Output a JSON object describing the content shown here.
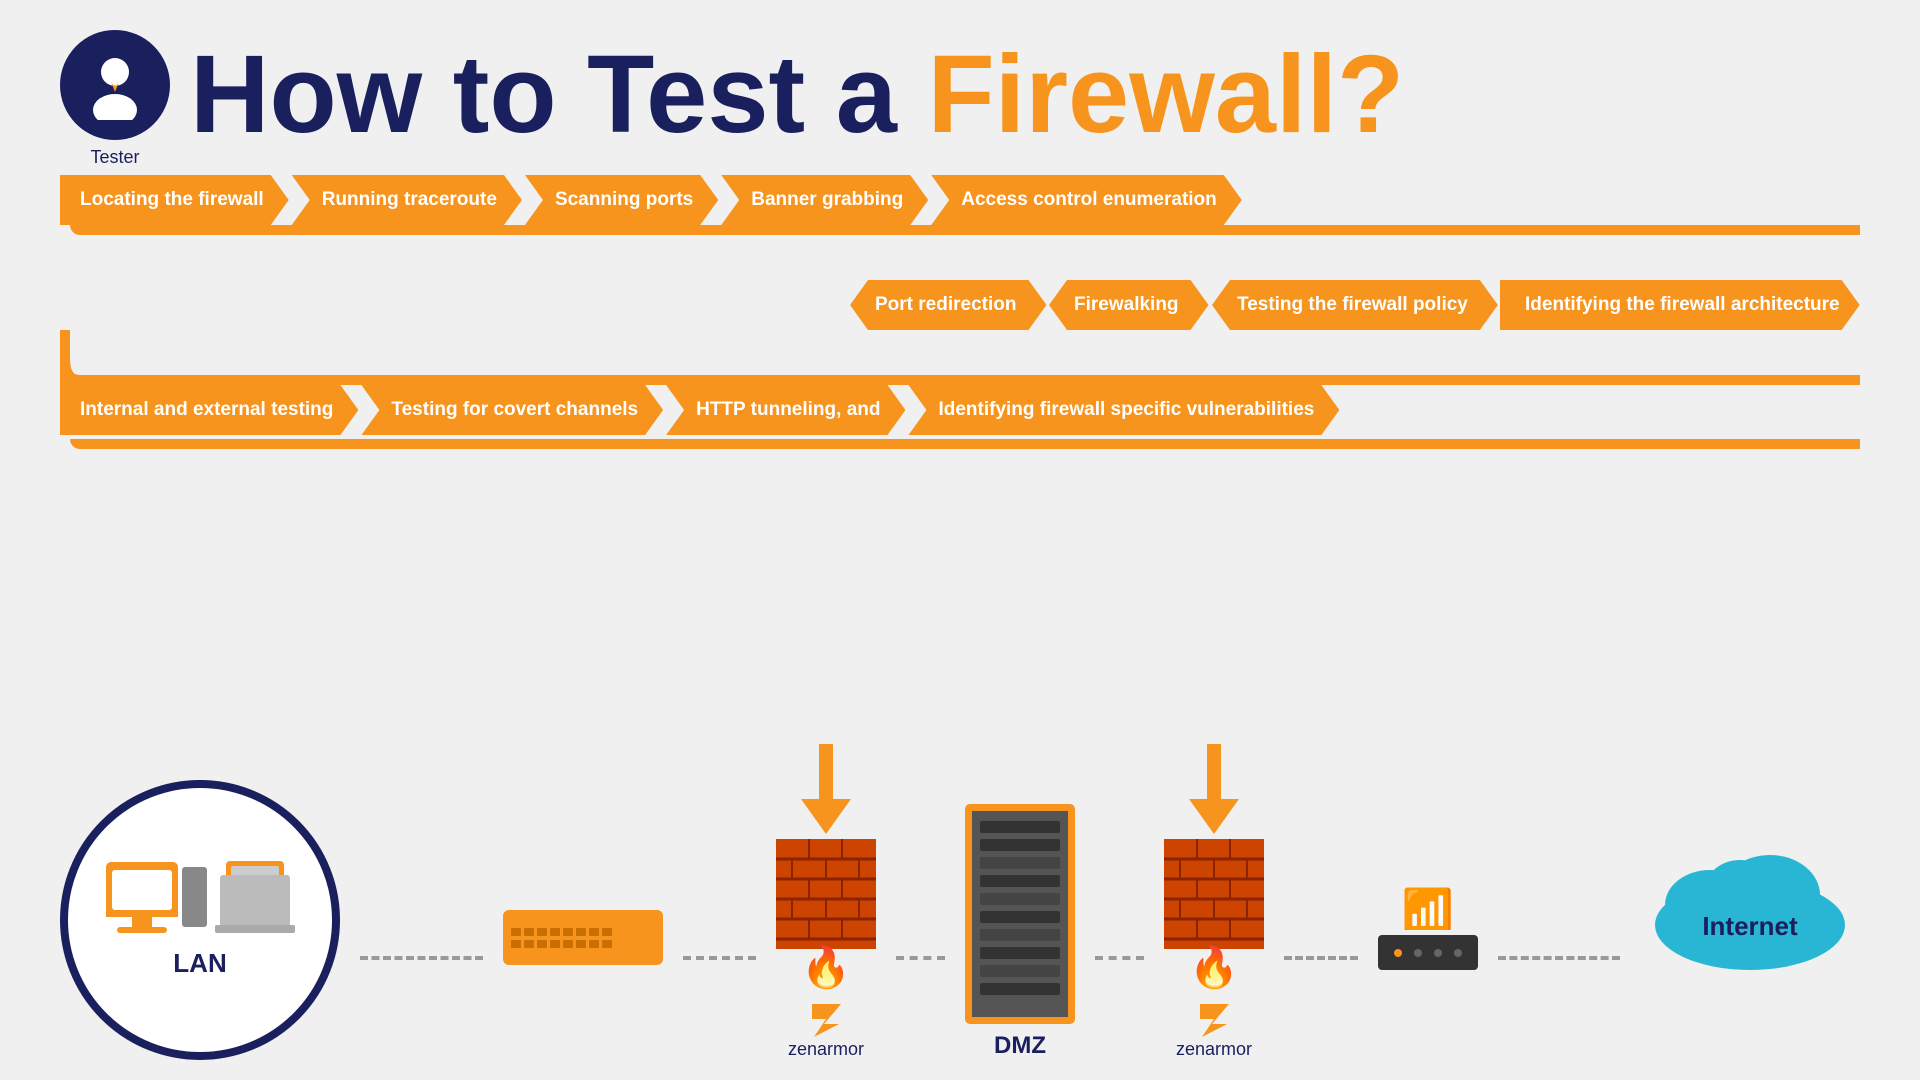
{
  "header": {
    "title_part1": "How to Test a ",
    "title_part2": "Firewall?",
    "tester_label": "Tester"
  },
  "steps": {
    "row1": [
      {
        "label": "Locating the firewall",
        "first": true
      },
      {
        "label": "Running traceroute",
        "first": false
      },
      {
        "label": "Scanning ports",
        "first": false
      },
      {
        "label": "Banner grabbing",
        "first": false
      },
      {
        "label": "Access control enumeration",
        "first": false
      }
    ],
    "row2": [
      {
        "label": "Port redirection",
        "first": true
      },
      {
        "label": "Firewalking",
        "first": false
      },
      {
        "label": "Testing the firewall policy",
        "first": false
      },
      {
        "label": "Identifying the firewall architecture",
        "first": false
      }
    ],
    "row3": [
      {
        "label": "Internal and external testing",
        "first": true
      },
      {
        "label": "Testing for covert channels",
        "first": false
      },
      {
        "label": "HTTP tunneling, and",
        "first": false
      },
      {
        "label": "Identifying firewall specific vulnerabilities",
        "first": false
      }
    ]
  },
  "diagram": {
    "lan_label": "LAN",
    "dmz_label": "DMZ",
    "internet_label": "Internet",
    "zenarmor_label": "zenarmor",
    "tester_label": "Tester"
  },
  "colors": {
    "orange": "#f7941d",
    "navy": "#1a1f5e",
    "bg": "#f0f0f0"
  }
}
